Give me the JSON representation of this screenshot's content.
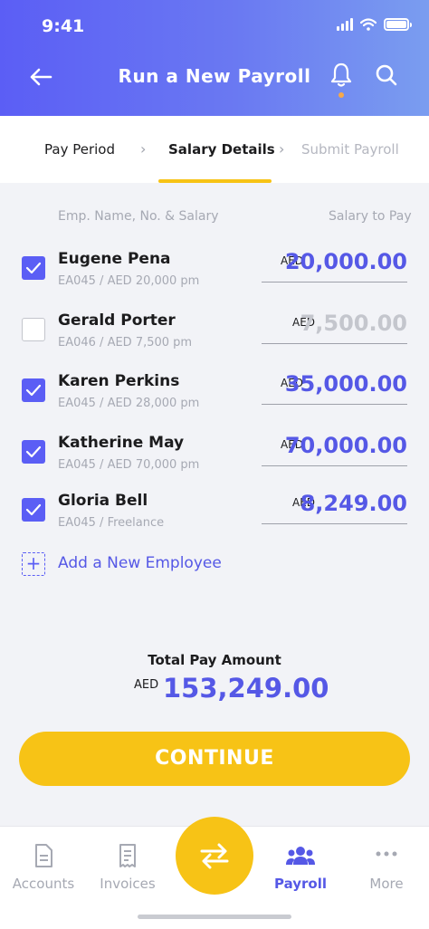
{
  "status": {
    "time": "9:41"
  },
  "header": {
    "title": "Run a New Payroll"
  },
  "steps": [
    "Pay Period",
    "Salary Details",
    "Submit Payroll"
  ],
  "columns": {
    "left": "Emp. Name, No. & Salary",
    "right": "Salary to Pay"
  },
  "employees": [
    {
      "name": "Eugene Pena",
      "sub": "EA045 / AED 20,000 pm",
      "currency": "AED",
      "amount": "20,000.00",
      "checked": true
    },
    {
      "name": "Gerald Porter",
      "sub": "EA046 / AED 7,500 pm",
      "currency": "AED",
      "amount": "7,500.00",
      "checked": false
    },
    {
      "name": "Karen Perkins",
      "sub": "EA045 / AED 28,000 pm",
      "currency": "AED",
      "amount": "35,000.00",
      "checked": true
    },
    {
      "name": "Katherine May",
      "sub": "EA045 / AED 70,000 pm",
      "currency": "AED",
      "amount": "70,000.00",
      "checked": true
    },
    {
      "name": "Gloria Bell",
      "sub": "EA045 / Freelance",
      "currency": "AED",
      "amount": "8,249.00",
      "checked": true
    }
  ],
  "add_employee": {
    "label": "Add a New Employee"
  },
  "total": {
    "label": "Total Pay Amount",
    "currency": "AED",
    "amount": "153,249.00"
  },
  "continue_label": "CONTINUE",
  "tabs": [
    {
      "label": "Accounts",
      "icon": "document-icon",
      "active": false
    },
    {
      "label": "Invoices",
      "icon": "receipt-icon",
      "active": false
    },
    {
      "label": "Payroll",
      "icon": "people-icon",
      "active": true
    },
    {
      "label": "More",
      "icon": "more-dots-icon",
      "active": false
    }
  ],
  "colors": {
    "accent": "#5b5ef5",
    "cta": "#f7c316",
    "muted": "#a6a9b3"
  }
}
